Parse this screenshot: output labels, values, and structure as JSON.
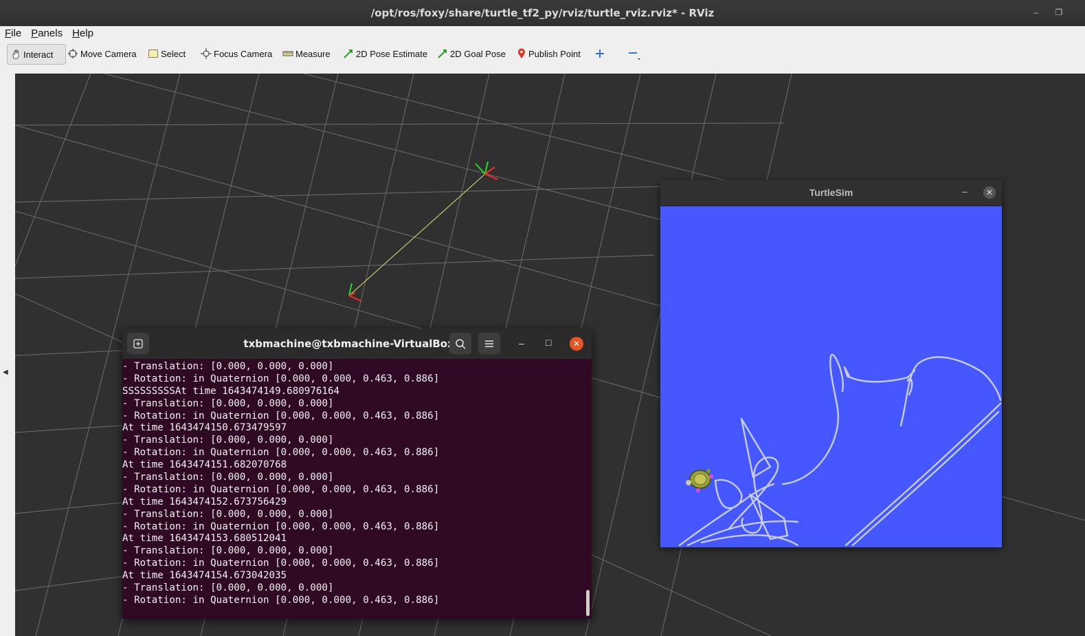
{
  "window": {
    "title": "/opt/ros/foxy/share/turtle_tf2_py/rviz/turtle_rviz.rviz* - RViz",
    "controls": [
      "minimize-icon",
      "restore-icon"
    ]
  },
  "menu": [
    {
      "label": "File",
      "accel": "F"
    },
    {
      "label": "Panels",
      "accel": "P"
    },
    {
      "label": "Help",
      "accel": "H"
    }
  ],
  "toolbar": {
    "interact": "Interact",
    "move_camera": "Move Camera",
    "select": "Select",
    "focus_camera": "Focus Camera",
    "measure": "Measure",
    "pose_estimate": "2D Pose Estimate",
    "goal_pose": "2D Goal Pose",
    "publish_point": "Publish Point",
    "add_tool_icon": "plus-icon",
    "remove_tool_icon": "minus-icon"
  },
  "turtlesim": {
    "title": "TurtleSim",
    "background": "#4557ff",
    "path_color": "#c8cdf7"
  },
  "terminal": {
    "title": "txbmachine@txbmachine-VirtualBox: ~",
    "lines": [
      "- Translation: [0.000, 0.000, 0.000]",
      "- Rotation: in Quaternion [0.000, 0.000, 0.463, 0.886]",
      "SSSSSSSSSAt time 1643474149.680976164",
      "- Translation: [0.000, 0.000, 0.000]",
      "- Rotation: in Quaternion [0.000, 0.000, 0.463, 0.886]",
      "At time 1643474150.673479597",
      "- Translation: [0.000, 0.000, 0.000]",
      "- Rotation: in Quaternion [0.000, 0.000, 0.463, 0.886]",
      "At time 1643474151.682070768",
      "- Translation: [0.000, 0.000, 0.000]",
      "- Rotation: in Quaternion [0.000, 0.000, 0.463, 0.886]",
      "At time 1643474152.673756429",
      "- Translation: [0.000, 0.000, 0.000]",
      "- Rotation: in Quaternion [0.000, 0.000, 0.463, 0.886]",
      "At time 1643474153.680512041",
      "- Translation: [0.000, 0.000, 0.000]",
      "- Rotation: in Quaternion [0.000, 0.000, 0.463, 0.886]",
      "At time 1643474154.673042035",
      "- Translation: [0.000, 0.000, 0.000]",
      "- Rotation: in Quaternion [0.000, 0.000, 0.463, 0.886]"
    ],
    "background": "#300a24"
  },
  "colors": {
    "grid": "#a0a0a0",
    "axis_x": "#ff2a2a",
    "axis_y": "#22dd22",
    "link": "#c8c86a"
  }
}
